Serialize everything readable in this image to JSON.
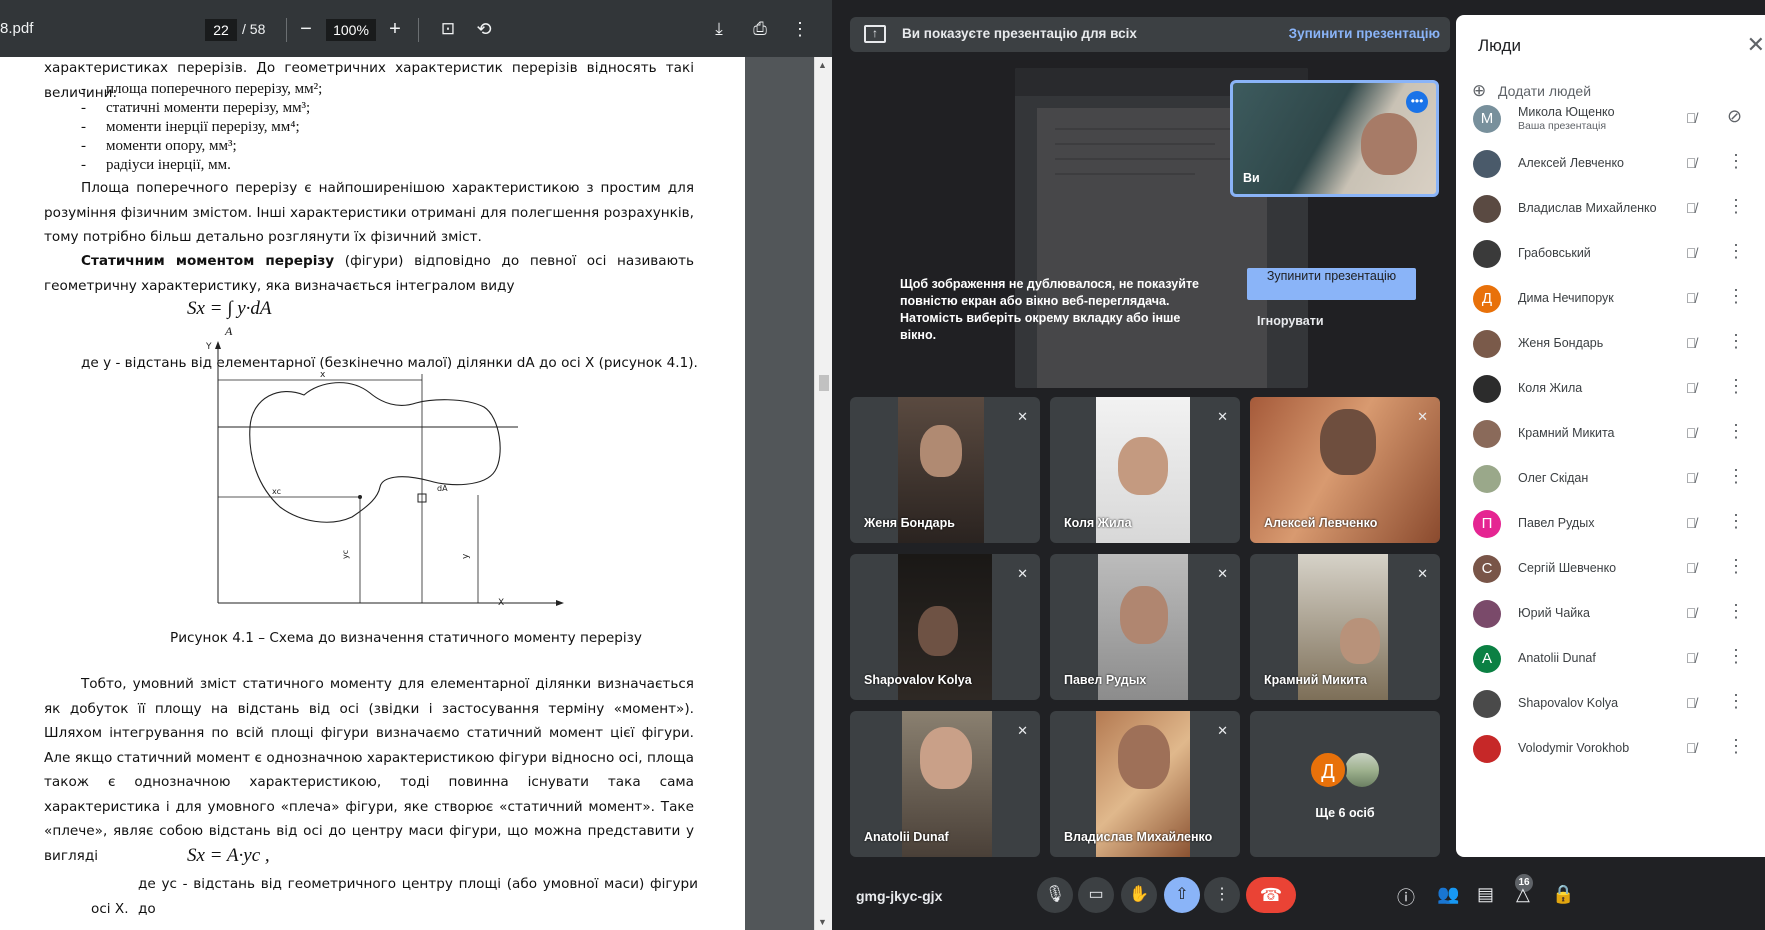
{
  "pdf": {
    "filename": "8.pdf",
    "page_current": "22",
    "page_total": "/ 58",
    "zoom": "100%",
    "content": {
      "intro_line": "характеристиках перерізів. До геометричних  характеристик перерізів відносять такі величини:",
      "bullets": [
        "площа поперечного перерізу, мм²;",
        "статичні моменти перерізу, мм³;",
        "моменти інерції перерізу, мм⁴;",
        "моменти опору, мм³;",
        "радіуси інерції, мм."
      ],
      "para1": "Площа поперечного перерізу є найпоширенішою характеристикою з простим для розуміння фізичним змістом. Інші характеристики отримані для полегшення розрахунків, тому потрібно більш детально розглянути їх фізичний зміст.",
      "para2_bold": "Статичним моментом перерізу",
      "para2_rest": " (фігури) відповідно до певної осі називають геометричну характеристику, яка визначається інтегралом виду",
      "formula1": "Sx = ∫ y·dA",
      "formula1_sub": "A",
      "where1": "де  y  - відстань від елементарної (безкінечно малої) ділянки   dA   до осі X (рисунок 4.1).",
      "figure_labels": {
        "y_axis": "Y",
        "x_axis": "X",
        "x": "x",
        "xc": "xc",
        "dA": "dA",
        "yc": "yc",
        "y": "y"
      },
      "caption": "Рисунок 4.1 – Схема до визначення статичного моменту перерізу",
      "para3": "Тобто, умовний зміст статичного моменту для елементарної ділянки визначається як добуток її площу на відстань від осі (звідки і застосування терміну «момент»). Шляхом інтегрування по всій площі фігури визначаємо статичний момент цієї фігури. Але якщо статичний момент є однозначною характеристикою фігури відносно осі, площа також є однозначною характеристикою, тоді повинна існувати така сама характеристика і для умовного «плеча» фігури, яке створює «статичний момент». Таке «плече», являє собою відстань від осі до  центру маси  фігури, що можна представити у вигляді",
      "formula2": "Sx = A·yc ,",
      "where2": "де  yc  - відстань від геометричного центру площі (або умовної маси) фігури до",
      "where2_end": "осі X."
    }
  },
  "meet": {
    "banner_text": "Ви показуєте презентацію для всіх",
    "banner_stop": "Зупинити презентацію",
    "warning": "Щоб зображення не дублювалося, не показуйте повністю екран або вікно веб-переглядача. Натомість виберіть окрему вкладку або інше вікно.",
    "stop_button": "Зупинити презентацію",
    "ignore_button": "Ігнорувати",
    "self_label": "Ви",
    "tiles": [
      {
        "name": "Женя Бондарь"
      },
      {
        "name": "Коля Жила"
      },
      {
        "name": "Алексей Левченко"
      },
      {
        "name": "Shapovalov Kolya"
      },
      {
        "name": "Павел Рудых"
      },
      {
        "name": "Крамний Микита"
      },
      {
        "name": "Anatolii Dunaf"
      },
      {
        "name": "Владислав Михайленко"
      }
    ],
    "more_tile": {
      "avatar_letter": "Д",
      "label": "Ще 6 осіб"
    },
    "meeting_code": "gmg-jkyc-gjx",
    "participant_count": "16",
    "colors": {
      "accent": "#8ab4f8",
      "end_call": "#ea4335",
      "bg": "#202124"
    }
  },
  "people": {
    "title": "Люди",
    "add_label": "Додати людей",
    "list": [
      {
        "name": "Микола Ющенко",
        "sub": "Ваша презентація",
        "letter": "М",
        "color": "#78909c"
      },
      {
        "name": "Алексей Левченко",
        "letter": "",
        "color": "#4a5a6a"
      },
      {
        "name": "Владислав Михайленко",
        "letter": "",
        "color": "#5a4a42"
      },
      {
        "name": "Грабовський",
        "letter": "",
        "color": "#3a3a3a"
      },
      {
        "name": "Дима Нечипорук",
        "letter": "Д",
        "color": "#e8710a"
      },
      {
        "name": "Женя Бондарь",
        "letter": "",
        "color": "#7a5a4a"
      },
      {
        "name": "Коля Жила",
        "letter": "",
        "color": "#2c2c2c"
      },
      {
        "name": "Крамний Микита",
        "letter": "",
        "color": "#8a6a5a"
      },
      {
        "name": "Олег Скідан",
        "letter": "",
        "color": "#9aa88a"
      },
      {
        "name": "Павел Рудых",
        "letter": "П",
        "color": "#e52592"
      },
      {
        "name": "Сергій Шевченко",
        "letter": "С",
        "color": "#795548"
      },
      {
        "name": "Юрий Чайка",
        "letter": "",
        "color": "#7a4a6a"
      },
      {
        "name": "Anatolii Dunaf",
        "letter": "A",
        "color": "#0b8043"
      },
      {
        "name": "Shapovalov Kolya",
        "letter": "",
        "color": "#4a4a4a"
      },
      {
        "name": "Volodymir Vorokhob",
        "letter": "",
        "color": "#c62828"
      }
    ]
  }
}
